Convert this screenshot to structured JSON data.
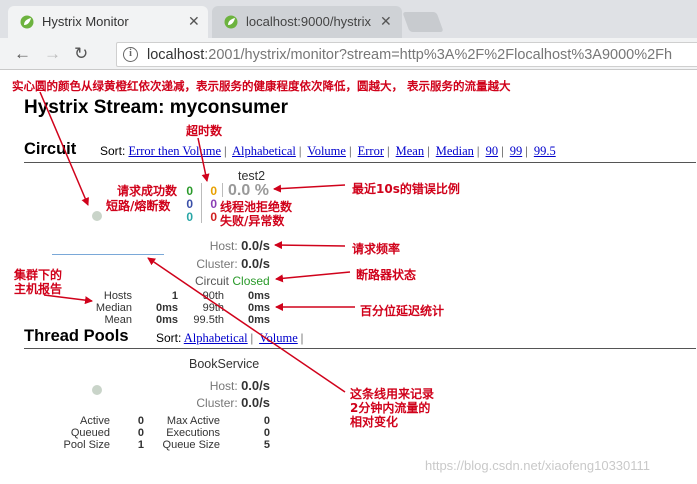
{
  "browser": {
    "tabs": [
      {
        "title": "Hystrix Monitor",
        "active": true
      },
      {
        "title": "localhost:9000/hystrix.s",
        "active": false
      }
    ],
    "url": {
      "host": "localhost",
      "rest": ":2001/hystrix/monitor?stream=http%3A%2F%2Flocalhost%3A9000%2Fh"
    }
  },
  "annotations": {
    "circle_color": "实心圆的颜色从绿黄橙红依次递减，表示服务的健康程度依次降低，圆越大，  表示服务的流量越大",
    "timeout": "超时数",
    "success": "请求成功数",
    "short_circuited": "短路/熔断数",
    "error_pct": "最近10s的错误比例",
    "thread_pool_rejected": "线程池拒绝数",
    "failure": "失败/异常数",
    "request_rate": "请求频率",
    "host_report_1": "集群下的",
    "host_report_2": "主机报告",
    "breaker_status": "断路器状态",
    "latency": "百分位延迟统计",
    "line_1": "这条线用来记录",
    "line_2": "2分钟内流量的",
    "line_3": "相对变化"
  },
  "stream_title": "Hystrix Stream: myconsumer",
  "circuit": {
    "heading": "Circuit",
    "sort_label": "Sort:",
    "sort_links": [
      "Error then Volume",
      "Alphabetical",
      "Volume",
      "Error",
      "Mean",
      "Median",
      "90",
      "99",
      "99.5"
    ],
    "card": {
      "name": "test2",
      "success": "0",
      "short_circuited": "0",
      "bad_request": "0",
      "timeout": "0",
      "rejected": "0",
      "failure": "0",
      "error_pct": "0.0 %",
      "host_label": "Host:",
      "host_rate": "0.0/s",
      "cluster_label": "Cluster:",
      "cluster_rate": "0.0/s",
      "circuit_label": "Circuit",
      "circuit_status": "Closed",
      "stats": {
        "rows": [
          {
            "label": "Hosts",
            "value": "1",
            "pct": "90th",
            "pct_value": "0ms"
          },
          {
            "label": "Median",
            "value": "0ms",
            "pct": "99th",
            "pct_value": "0ms"
          },
          {
            "label": "Mean",
            "value": "0ms",
            "pct": "99.5th",
            "pct_value": "0ms"
          }
        ]
      }
    }
  },
  "thread_pools": {
    "heading": "Thread Pools",
    "sort_label": "Sort:",
    "sort_links": [
      "Alphabetical",
      "Volume"
    ],
    "card": {
      "name": "BookService",
      "host_label": "Host:",
      "host_rate": "0.0/s",
      "cluster_label": "Cluster:",
      "cluster_rate": "0.0/s",
      "rows": [
        {
          "label": "Active",
          "value": "0",
          "label2": "Max Active",
          "value2": "0"
        },
        {
          "label": "Queued",
          "value": "0",
          "label2": "Executions",
          "value2": "0"
        },
        {
          "label": "Pool Size",
          "value": "1",
          "label2": "Queue Size",
          "value2": "5"
        }
      ]
    }
  },
  "watermark": "https://blog.csdn.net/xiaofeng10330111",
  "colors": {
    "annotation": "#d0021b",
    "link": "#0000cc",
    "closed": "#2a9a2a"
  }
}
